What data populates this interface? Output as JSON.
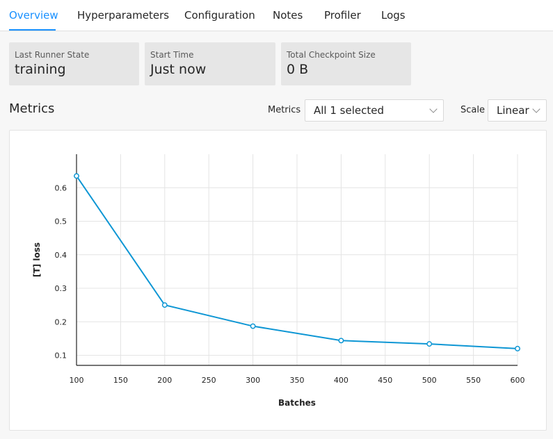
{
  "tabs": [
    {
      "label": "Overview",
      "active": true
    },
    {
      "label": "Hyperparameters"
    },
    {
      "label": "Configuration"
    },
    {
      "label": "Notes"
    },
    {
      "label": "Profiler"
    },
    {
      "label": "Logs"
    }
  ],
  "cards": [
    {
      "label": "Last Runner State",
      "value": "training"
    },
    {
      "label": "Start Time",
      "value": "Just now"
    },
    {
      "label": "Total Checkpoint Size",
      "value": "0 B"
    }
  ],
  "metrics": {
    "title": "Metrics",
    "metrics_label": "Metrics",
    "metrics_value": "All 1 selected",
    "scale_label": "Scale",
    "scale_value": "Linear"
  },
  "colors": {
    "accent": "#1890ff",
    "series": "#0d96d4"
  },
  "chart_data": {
    "type": "line",
    "xlabel": "Batches",
    "ylabel": "[T] loss",
    "xlim": [
      100,
      600
    ],
    "ylim": [
      0.07,
      0.7
    ],
    "xticks": [
      100,
      150,
      200,
      250,
      300,
      350,
      400,
      450,
      500,
      550,
      600
    ],
    "yticks": [
      0.1,
      0.2,
      0.3,
      0.4,
      0.5,
      0.6
    ],
    "grid": true,
    "series": [
      {
        "x": [
          100,
          200,
          300,
          400,
          500,
          600
        ],
        "values": [
          0.635,
          0.25,
          0.187,
          0.144,
          0.134,
          0.12
        ]
      }
    ]
  }
}
